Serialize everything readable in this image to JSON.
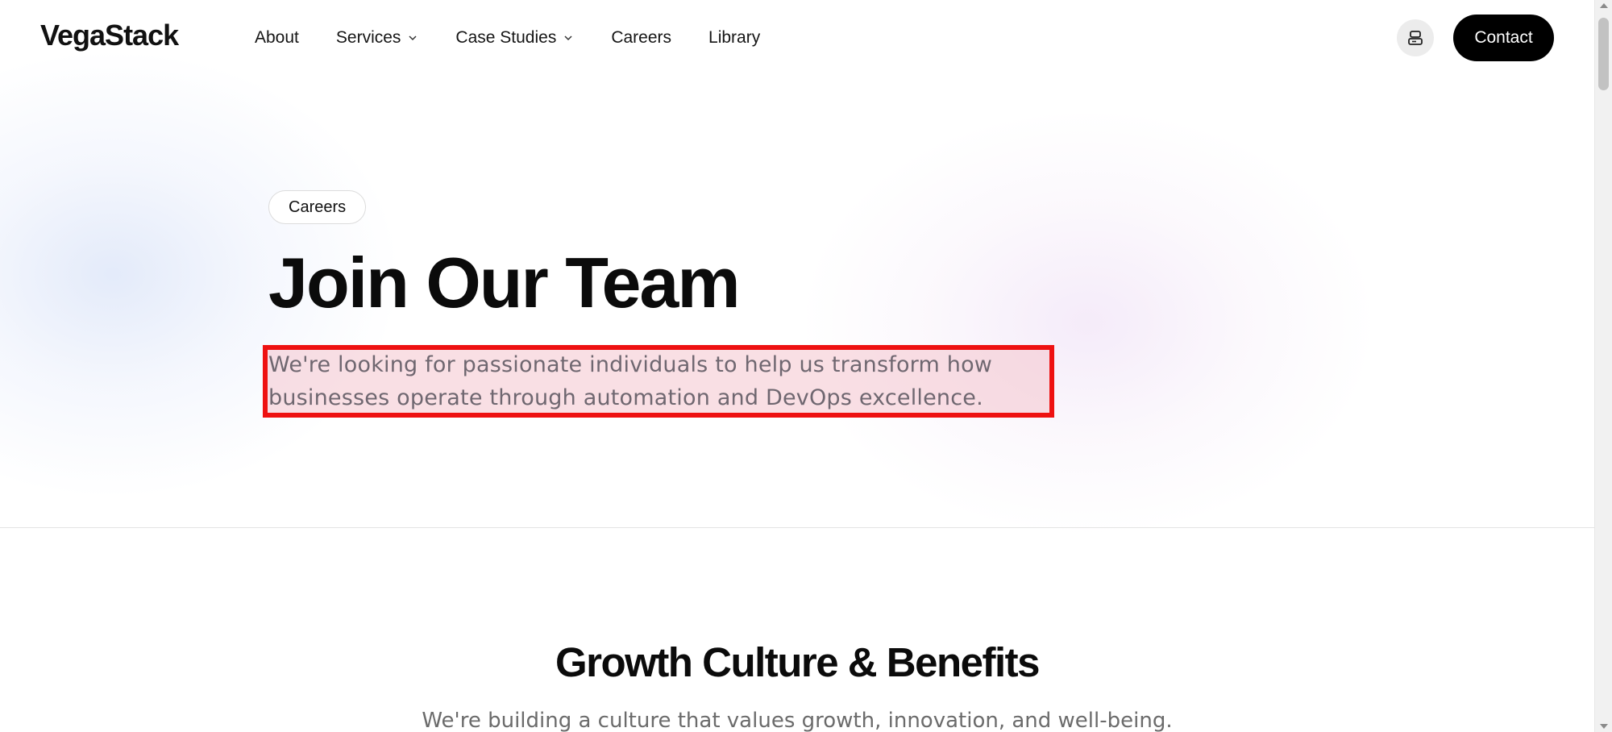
{
  "header": {
    "logo_text": "VegaStack",
    "nav": [
      {
        "label": "About",
        "has_dropdown": false
      },
      {
        "label": "Services",
        "has_dropdown": true
      },
      {
        "label": "Case Studies",
        "has_dropdown": true
      },
      {
        "label": "Careers",
        "has_dropdown": false
      },
      {
        "label": "Library",
        "has_dropdown": false
      }
    ],
    "icon_button": "card-toggle-icon",
    "contact_label": "Contact"
  },
  "hero": {
    "pill_label": "Careers",
    "title": "Join Our Team",
    "description": "We're looking for passionate individuals to help us transform how businesses operate through automation and DevOps excellence.",
    "highlight_color": "#ee1111"
  },
  "section": {
    "title": "Growth Culture & Benefits",
    "subtitle": "We're building a culture that values growth, innovation, and well-being."
  },
  "colors": {
    "primary_button": "#000000",
    "text_muted": "#6f6770"
  }
}
